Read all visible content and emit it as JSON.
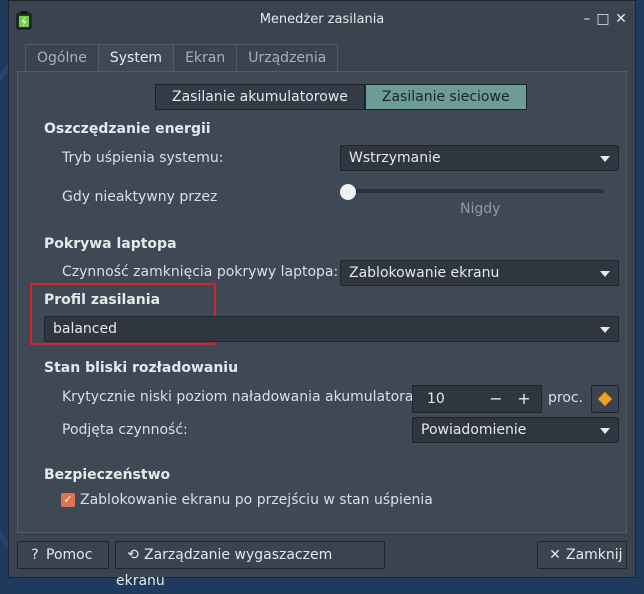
{
  "window": {
    "title": "Menedżer zasilania",
    "minimize": "–",
    "maximize": "□",
    "close": "✕"
  },
  "tabs": [
    {
      "label": "Ogólne",
      "active": false
    },
    {
      "label": "System",
      "active": true
    },
    {
      "label": "Ekran",
      "active": false
    },
    {
      "label": "Urządzenia",
      "active": false
    }
  ],
  "power_source": {
    "battery": "Zasilanie akumulatorowe",
    "ac": "Zasilanie sieciowe",
    "selected": "ac"
  },
  "energy_saving": {
    "heading": "Oszczędzanie energii",
    "sleep_mode_label": "Tryb uśpienia systemu:",
    "sleep_mode_value": "Wstrzymanie",
    "inactive_label": "Gdy nieaktywny przez",
    "inactive_value": "Nigdy",
    "inactive_level": 0
  },
  "lid": {
    "heading": "Pokrywa laptopa",
    "action_label": "Czynność zamknięcia pokrywy laptopa:",
    "action_value": "Zablokowanie ekranu"
  },
  "profile": {
    "heading": "Profil zasilania",
    "value": "balanced"
  },
  "critical": {
    "heading": "Stan bliski rozładowaniu",
    "level_label": "Krytycznie niski poziom naładowania akumulatora:",
    "level_value": "10",
    "minus": "−",
    "plus": "+",
    "unit": "proc.",
    "action_label": "Podjęta czynność:",
    "action_value": "Powiadomienie"
  },
  "security": {
    "heading": "Bezpieczeństwo",
    "lock_label": "Zablokowanie ekranu po przejściu w stan uśpienia",
    "lock_checked": true,
    "check_mark": "✓"
  },
  "buttons": {
    "help": "Pomoc",
    "help_icon": "?",
    "screensaver": "Zarządzanie wygaszaczem ekranu",
    "screensaver_icon": "⟲",
    "close": "Zamknij",
    "close_icon": "✕"
  },
  "colors": {
    "accent": "#6b9c96",
    "highlight_box": "#d9232b",
    "checkbox": "#e1734f",
    "diamond": "#f0a01c"
  }
}
